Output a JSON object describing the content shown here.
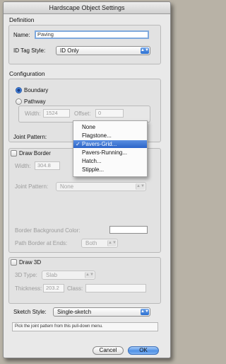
{
  "window": {
    "title": "Hardscape Object Settings"
  },
  "definition": {
    "section_label": "Definition",
    "name_label": "Name:",
    "name_value": "Paving",
    "id_tag_label": "ID Tag Style:",
    "id_tag_value": "ID Only"
  },
  "configuration": {
    "section_label": "Configuration",
    "boundary_label": "Boundary",
    "pathway_label": "Pathway",
    "width_label": "Width:",
    "width_value": "1524",
    "offset_label": "Offset:",
    "offset_value": "0",
    "joint_pattern_label": "Joint Pattern:",
    "boundary_selected": true
  },
  "joint_pattern_menu": {
    "items": [
      "None",
      "Flagstone...",
      "Pavers-Grid...",
      "Pavers-Running...",
      "Hatch...",
      "Stipple..."
    ],
    "selected_index": 2,
    "check_glyph": "✓"
  },
  "border": {
    "checkbox_label": "Draw Border",
    "width_label": "Width:",
    "width_value": "304.8",
    "joint_pattern_label": "Joint Pattern:",
    "joint_pattern_value": "None",
    "bg_color_label": "Border Background Color:",
    "path_border_label": "Path Border at Ends:",
    "path_border_value": "Both"
  },
  "draw3d": {
    "checkbox_label": "Draw 3D",
    "type_label": "3D Type:",
    "type_value": "Slab",
    "thickness_label": "Thickness:",
    "thickness_value": "203.2",
    "class_label": "Class:",
    "class_value": ""
  },
  "sketch": {
    "label": "Sketch Style:",
    "value": "Single-sketch"
  },
  "hint_text": "Pick the joint pattern from this pull-down menu.",
  "buttons": {
    "cancel": "Cancel",
    "ok": "OK"
  },
  "icons": {
    "popup_arrow": "chevron-updown-icon"
  },
  "colors": {
    "accent": "#2b6fd1",
    "focus_ring": "#7fa9dd",
    "menu_highlight": "#3a72d4"
  }
}
